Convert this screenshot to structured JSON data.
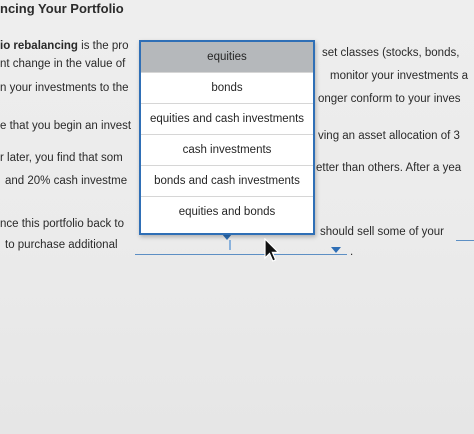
{
  "page": {
    "title": "ncing Your Portfolio"
  },
  "paragraph": {
    "line1_bold": "io rebalancing",
    "line1_rest": " is the pro",
    "line1_right": "set classes (stocks, bonds,",
    "line2_left": "nt change in the value of",
    "line2_right": "monitor your investments a",
    "line3_left": "n your investments to the",
    "line3_right": "onger conform to your inves",
    "line4_left": "e that you begin an invest",
    "line4_right": "ving an asset allocation of 3",
    "line5_left": "r later, you find that som",
    "line5_right": "etter than others. After a yea",
    "line6_left": "and 20% cash investme",
    "line7_left": "nce this portfolio back to",
    "line7_right": "should sell some of your",
    "line8_left": "to purchase additional",
    "line8_end": "."
  },
  "dropdown": {
    "options": [
      "equities",
      "bonds",
      "equities and cash investments",
      "cash investments",
      "bonds and cash investments",
      "equities and bonds"
    ]
  },
  "colors": {
    "accent": "#2f6fb6",
    "selected_bg": "#b5b8bb"
  }
}
